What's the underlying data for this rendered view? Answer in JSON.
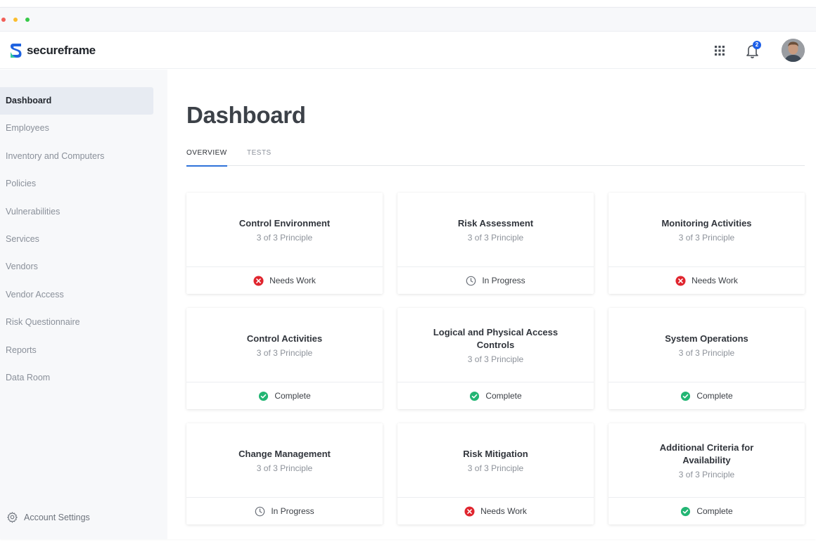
{
  "app": {
    "logo_text": "secureframe"
  },
  "header": {
    "notification_count": "2"
  },
  "sidebar": {
    "items": [
      {
        "label": "Dashboard",
        "active": true
      },
      {
        "label": "Employees"
      },
      {
        "label": "Inventory and Computers"
      },
      {
        "label": "Policies"
      },
      {
        "label": "Vulnerabilities"
      },
      {
        "label": "Services"
      },
      {
        "label": "Vendors"
      },
      {
        "label": "Vendor Access"
      },
      {
        "label": "Risk Questionnaire"
      },
      {
        "label": "Reports"
      },
      {
        "label": "Data Room"
      }
    ],
    "account_settings": "Account Settings"
  },
  "main": {
    "title": "Dashboard",
    "tabs": [
      {
        "label": "OVERVIEW",
        "active": true
      },
      {
        "label": "TESTS"
      }
    ],
    "cards": [
      {
        "title": "Control Environment",
        "subtitle": "3 of 3 Principle",
        "status": "Needs Work",
        "status_icon": "x-circle-icon"
      },
      {
        "title": "Risk Assessment",
        "subtitle": "3 of 3 Principle",
        "status": "In Progress",
        "status_icon": "clock-icon"
      },
      {
        "title": "Monitoring Activities",
        "subtitle": "3 of 3 Principle",
        "status": "Needs Work",
        "status_icon": "x-circle-icon"
      },
      {
        "title": "Control Activities",
        "subtitle": "3 of 3 Principle",
        "status": "Complete",
        "status_icon": "check-circle-icon"
      },
      {
        "title": "Logical and Physical Access Controls",
        "subtitle": "3 of 3 Principle",
        "status": "Complete",
        "status_icon": "check-circle-icon"
      },
      {
        "title": "System Operations",
        "subtitle": "3 of 3 Principle",
        "status": "Complete",
        "status_icon": "check-circle-icon"
      },
      {
        "title": "Change Management",
        "subtitle": "3 of 3 Principle",
        "status": "In Progress",
        "status_icon": "clock-icon"
      },
      {
        "title": "Risk Mitigation",
        "subtitle": "3 of 3 Principle",
        "status": "Needs Work",
        "status_icon": "x-circle-icon"
      },
      {
        "title": "Additional Criteria for Availability",
        "subtitle": "3 of 3 Principle",
        "status": "Complete",
        "status_icon": "check-circle-icon"
      }
    ]
  },
  "colors": {
    "accent": "#2f72d9",
    "needs_work": "#e0252e",
    "complete": "#22b573",
    "in_progress": "#6b7079",
    "badge": "#1d5fe8"
  }
}
